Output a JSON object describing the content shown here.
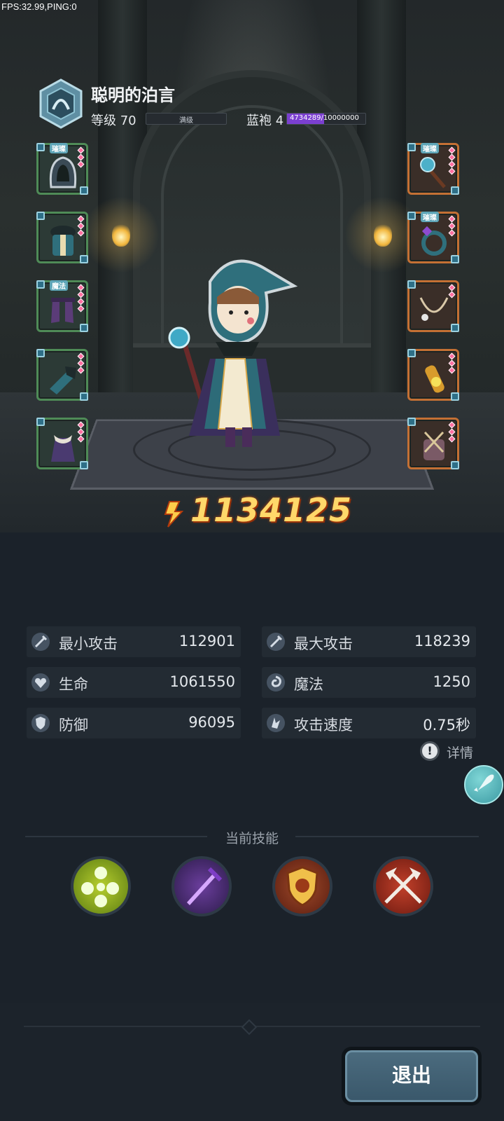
{
  "debug": {
    "fps_text": "FPS:32.99,PING:0"
  },
  "player": {
    "name": "聪明的泊言",
    "level_label": "等级 70",
    "level_bar_text": "满级",
    "rank_label": "蓝袍 4",
    "exp_text": "4734289/10000000",
    "exp_progress": 0.47
  },
  "equipment": {
    "left": [
      {
        "name": "hood",
        "tag": "璀璨",
        "rarity": "green"
      },
      {
        "name": "armor",
        "tag": "",
        "rarity": "green"
      },
      {
        "name": "boots",
        "tag": "魔法",
        "rarity": "green"
      },
      {
        "name": "gloves",
        "tag": "",
        "rarity": "green"
      },
      {
        "name": "cloak",
        "tag": "",
        "rarity": "green"
      }
    ],
    "right": [
      {
        "name": "staff",
        "tag": "璀璨",
        "rarity": "orange"
      },
      {
        "name": "ring",
        "tag": "璀璨",
        "rarity": "orange"
      },
      {
        "name": "necklace",
        "tag": "",
        "rarity": "orange"
      },
      {
        "name": "amulet",
        "tag": "",
        "rarity": "orange"
      },
      {
        "name": "relic",
        "tag": "",
        "rarity": "orange"
      }
    ]
  },
  "combat_power": "1134125",
  "stats": {
    "min_attack": {
      "label": "最小攻击",
      "value": "112901",
      "icon": "sword-icon"
    },
    "max_attack": {
      "label": "最大攻击",
      "value": "118239",
      "icon": "sword-icon"
    },
    "hp": {
      "label": "生命",
      "value": "1061550",
      "icon": "heart-icon"
    },
    "magic": {
      "label": "魔法",
      "value": "1250",
      "icon": "swirl-icon"
    },
    "defense": {
      "label": "防御",
      "value": "96095",
      "icon": "shield-icon"
    },
    "attack_speed": {
      "label": "攻击速度",
      "value": "0.75秒",
      "icon": "wing-icon"
    }
  },
  "details_label": "详情",
  "skills": {
    "title": "当前技能",
    "items": [
      {
        "name": "poison-bubbles-skill"
      },
      {
        "name": "purple-sword-skill"
      },
      {
        "name": "golden-crest-skill"
      },
      {
        "name": "crossed-axes-skill"
      }
    ]
  },
  "exit_label": "退出",
  "colors": {
    "accent": "#ffd86a",
    "panel": "#1b222a",
    "exp_fill": "#7b3fd0"
  }
}
